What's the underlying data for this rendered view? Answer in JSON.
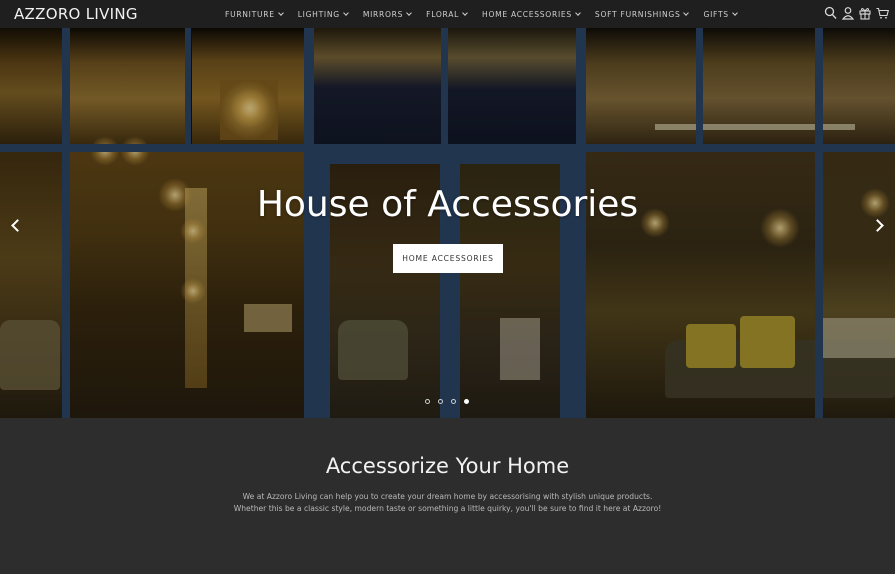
{
  "header": {
    "logo": "AZZORO LIVING",
    "nav": [
      {
        "label": "FURNITURE"
      },
      {
        "label": "LIGHTING"
      },
      {
        "label": "MIRRORS"
      },
      {
        "label": "FLORAL"
      },
      {
        "label": "HOME ACCESSORIES"
      },
      {
        "label": "SOFT FURNISHINGS"
      },
      {
        "label": "GIFTS"
      }
    ],
    "icons": [
      "search-icon",
      "account-icon",
      "gift-icon",
      "cart-icon"
    ]
  },
  "hero": {
    "title": "House of Accessories",
    "button_label": "HOME ACCESSORIES",
    "slide_count": 4,
    "active_slide": 4,
    "image_description": "Night view of shop front windows filled with illuminated chandeliers, lamps, armchairs and a sofa with zebra cushions"
  },
  "intro": {
    "title": "Accessorize Your Home",
    "lines": [
      "We at Azzoro Living can help you to create your dream home by accessorising with stylish unique products.",
      "Whether this be a classic style, modern taste or something a little quirky, you'll be sure to find it here at Azzoro!"
    ]
  },
  "colors": {
    "header_bg": "#1f1f1f",
    "section_bg": "#2d2d2d",
    "window_frame": "#2f4a6e",
    "button_bg": "#ffffff"
  }
}
